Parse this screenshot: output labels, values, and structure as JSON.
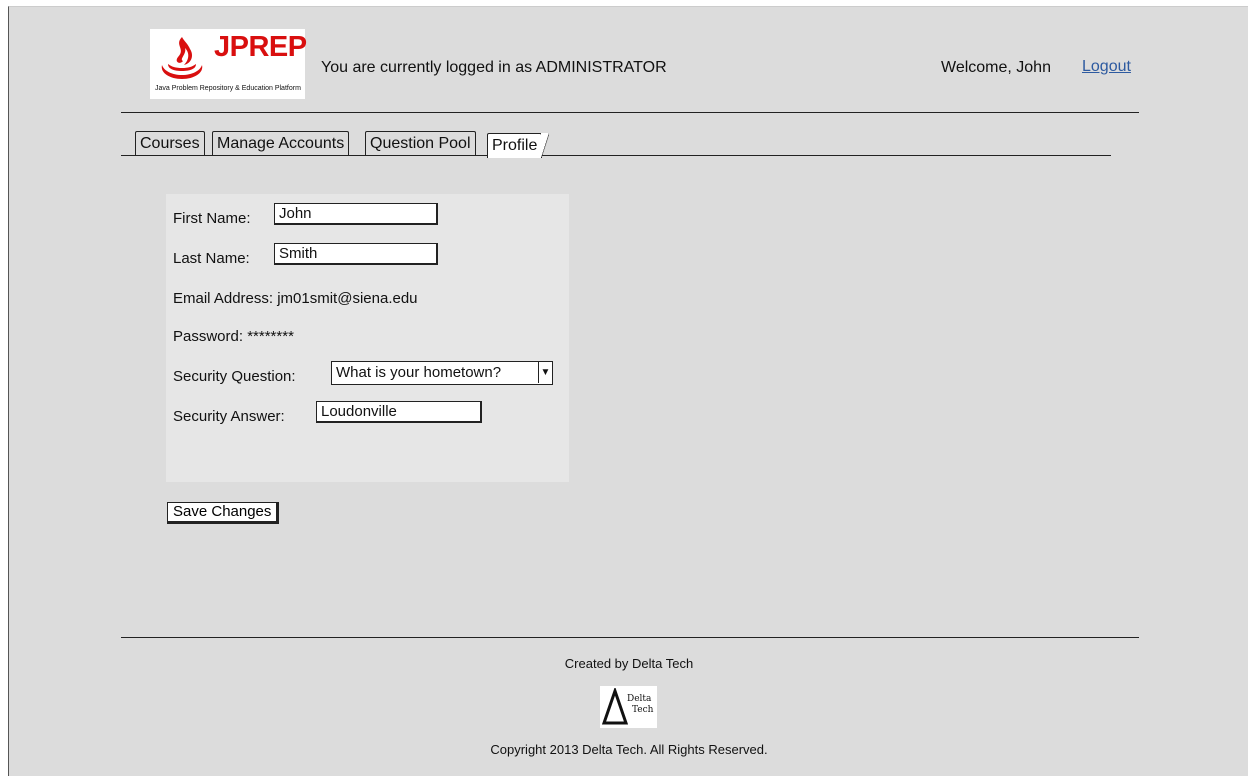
{
  "header": {
    "logo_title": "JPREP",
    "logo_subtitle": "Java Problem Repository & Education Platform",
    "login_status": "You are currently logged in as ADMINISTRATOR",
    "welcome": "Welcome, John",
    "logout": "Logout"
  },
  "tabs": [
    {
      "label": "Courses"
    },
    {
      "label": "Manage Accounts"
    },
    {
      "label": "Question Pool"
    },
    {
      "label": "Profile",
      "active": true
    }
  ],
  "profile": {
    "first_name_label": "First Name:",
    "first_name_value": "John",
    "last_name_label": "Last Name:",
    "last_name_value": "Smith",
    "email_label": "Email Address:",
    "email_value": "jm01smit@siena.edu",
    "password_label": "Password:",
    "password_value": "********",
    "security_question_label": "Security Question:",
    "security_question_value": "What is your hometown?",
    "security_answer_label": "Security Answer:",
    "security_answer_value": "Loudonville"
  },
  "save_button": "Save Changes",
  "footer": {
    "created_by": "Created by Delta Tech",
    "logo_line1": "Delta",
    "logo_line2": "Tech",
    "copyright": "Copyright 2013 Delta Tech. All Rights Reserved."
  },
  "colors": {
    "brand_red": "#d90f0f",
    "link_blue": "#2d5aa0",
    "background": "#dcdcdc"
  }
}
